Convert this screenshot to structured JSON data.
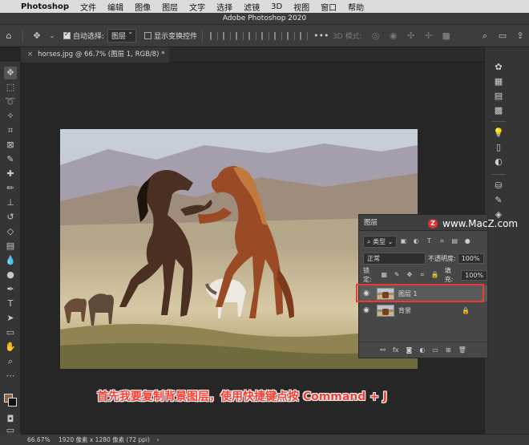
{
  "menubar": {
    "app": "Photoshop",
    "items": [
      "文件",
      "编辑",
      "图像",
      "图层",
      "文字",
      "选择",
      "滤镜",
      "3D",
      "视图",
      "窗口",
      "帮助"
    ]
  },
  "window": {
    "title": "Adobe Photoshop 2020"
  },
  "options": {
    "auto_select_label": "自动选择:",
    "auto_select_value": "图层",
    "show_transform_label": "显示变换控件",
    "mode_3d_label": "3D 模式:"
  },
  "document_tab": {
    "label": "horses.jpg @ 66.7% (图层 1, RGB/8) *",
    "close": "×"
  },
  "layers_panel": {
    "title": "图层",
    "filter_kind": "类型",
    "blend_mode": "正常",
    "opacity_label": "不透明度:",
    "opacity_value": "100%",
    "lock_label": "锁定:",
    "fill_label": "填充:",
    "fill_value": "100%",
    "layers": [
      {
        "name": "图层 1",
        "selected": true
      },
      {
        "name": "背景",
        "selected": false,
        "locked": true
      }
    ]
  },
  "watermark": {
    "text": "www.MacZ.com",
    "logo": "Z"
  },
  "caption": "首先我要复制背景图层，使用快捷键点按 Command + J",
  "status": {
    "zoom": "66.67%",
    "info": "1920 像素 x 1280 像素 (72 ppi)"
  },
  "colors": {
    "foreground": "#8a6545",
    "background": "#111111",
    "highlight": "#ee3b32",
    "caption": "#ff3b30"
  }
}
